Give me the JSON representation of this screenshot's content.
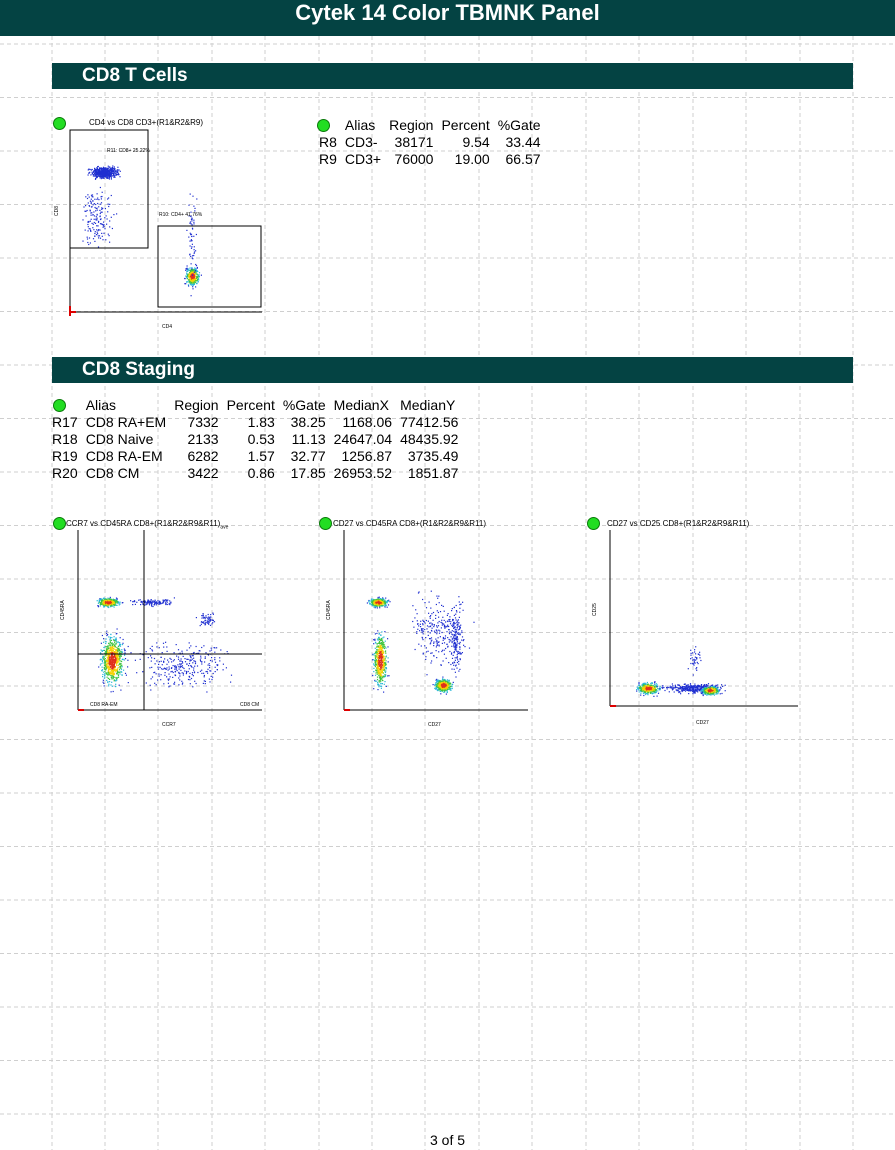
{
  "header": {
    "title": "Cytek 14 Color TBMNK Panel"
  },
  "sections": {
    "cd8_t_cells": {
      "title": "CD8 T Cells"
    },
    "cd8_staging": {
      "title": "CD8 Staging"
    }
  },
  "plots": {
    "cd4_cd8": {
      "title": "CD4 vs CD8  CD3+(R1&R2&R9)",
      "xlabel": "CD4",
      "ylabel": "CD8",
      "gate_r11": "R11: CD8+  25.22%",
      "gate_r10": "R10: CD4+  41.76%"
    },
    "ccr7_cd45ra": {
      "title": "CCR7 vs CD45RA  CD8+(R1&R2&R9&R11)",
      "title_suffix": "ave",
      "xlabel": "CCR7",
      "ylabel": "CD45RA",
      "quad_ll": "CD8 RA-EM",
      "quad_lr": "CD8 CM"
    },
    "cd27_cd45ra": {
      "title": "CD27 vs CD45RA  CD8+(R1&R2&R9&R11)",
      "xlabel": "CD27",
      "ylabel": "CD45RA"
    },
    "cd27_cd25": {
      "title": "CD27 vs CD25  CD8+(R1&R2&R9&R11)",
      "xlabel": "CD27",
      "ylabel": "CD25"
    }
  },
  "stats_t": {
    "headers": [
      "",
      "Alias",
      "Region",
      "Percent",
      "%Gate"
    ],
    "rows": [
      [
        "R8",
        "CD3-",
        "38171",
        "9.54",
        "33.44"
      ],
      [
        "R9",
        "CD3+",
        "76000",
        "19.00",
        "66.57"
      ]
    ]
  },
  "stats_staging": {
    "headers": [
      "",
      "Alias",
      "Region",
      "Percent",
      "%Gate",
      "MedianX",
      "MedianY"
    ],
    "rows": [
      [
        "R17",
        "CD8 RA+EM",
        "7332",
        "1.83",
        "38.25",
        "1168.06",
        "77412.56"
      ],
      [
        "R18",
        "CD8 Naive",
        "2133",
        "0.53",
        "11.13",
        "24647.04",
        "48435.92"
      ],
      [
        "R19",
        "CD8 RA-EM",
        "6282",
        "1.57",
        "32.77",
        "1256.87",
        "3735.49"
      ],
      [
        "R20",
        "CD8 CM",
        "3422",
        "0.86",
        "17.85",
        "26953.52",
        "1851.87"
      ]
    ]
  },
  "footer": {
    "page": "3 of 5"
  },
  "colors": {
    "header": "#044343",
    "marker": "#22dd22"
  }
}
